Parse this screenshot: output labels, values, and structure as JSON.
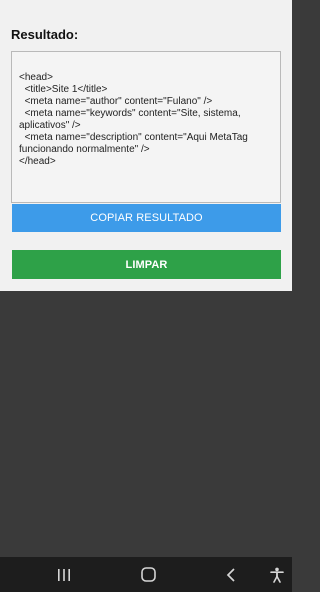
{
  "result": {
    "label": "Resultado:",
    "text": "<head>\n  <title>Site 1</title>\n  <meta name=\"author\" content=\"Fulano\" />\n  <meta name=\"keywords\" content=\"Site, sistema, aplicativos\" />\n  <meta name=\"description\" content=\"Aqui MetaTag funcionando normalmente\" />\n</head>"
  },
  "buttons": {
    "copy_label": "COPIAR RESULTADO",
    "clear_label": "LIMPAR"
  },
  "navbar": {
    "icons": [
      "recent-apps-icon",
      "home-icon",
      "back-icon",
      "accessibility-icon"
    ]
  },
  "colors": {
    "copy_button": "#3d9be9",
    "clear_button": "#2ea148",
    "background_dark": "#3a3a3a",
    "navbar": "#1d1d1d"
  }
}
